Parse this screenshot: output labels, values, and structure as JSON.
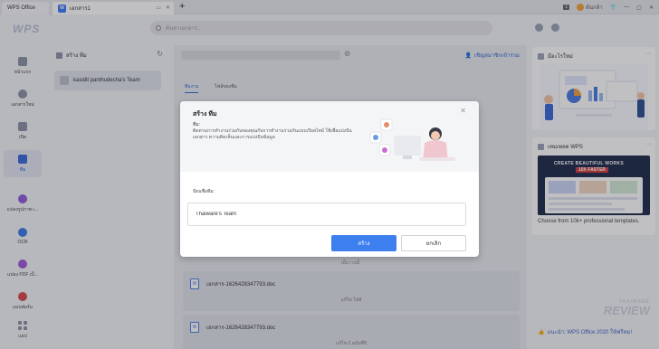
{
  "tabs": {
    "app_label": "WPS Office",
    "doc_label": "เอกสาร1",
    "doc_icon_letter": "W",
    "new_tab": "+"
  },
  "topbar": {
    "badge": "1",
    "user": "ต้นกล้า",
    "icons": [
      "minimize-icon",
      "shirt-icon",
      "settings-icon"
    ]
  },
  "header": {
    "logo": "WPS",
    "search_placeholder": "ค้นหาเอกสาร..."
  },
  "leftnav": {
    "items": [
      {
        "label": "หน้าแรก",
        "icon": "home-icon"
      },
      {
        "label": "เอกสารใหม่",
        "icon": "new-doc-icon"
      },
      {
        "label": "เปิด",
        "icon": "folder-icon"
      },
      {
        "label": "ทีม",
        "icon": "team-icon",
        "active": true
      },
      {
        "label": "แปลงรูปภาพ เ...",
        "icon": "pic-convert-icon"
      },
      {
        "label": "OCR",
        "icon": "ocr-icon"
      },
      {
        "label": "แปลง PDF เป็...",
        "icon": "pdf-convert-icon"
      },
      {
        "label": "แบบฟอร์ม",
        "icon": "form-icon"
      },
      {
        "label": "แอป",
        "icon": "apps-icon"
      }
    ]
  },
  "teampanel": {
    "header": "สร้าง ทีม",
    "team_name": "kasidit panthudecha's Team"
  },
  "main": {
    "invite": "เชิญสมาชิกเข้าร่วม",
    "tabs": [
      "ทีมงาน",
      "ไฟล์ของทีม"
    ],
    "history_label": "เมื่อวานนี้",
    "files": [
      {
        "name": "เอกสาร-1626428347793.doc",
        "meta": "แก้ไข ไฟล์"
      },
      {
        "name": "เอกสาร-1626428347793.doc",
        "meta": "แก้ไข 2 ฉบับที่ปิ"
      }
    ]
  },
  "rightpanel": {
    "card1_title": "มีอะไรใหม่",
    "card2_title": "เทมเพลต WPS",
    "promo_line1": "CREATE BEAUTIFUL WORKS",
    "promo_line2": "10X FASTER",
    "promo_desc": "Choose from 10k+ professional templates.",
    "bottom_link": "แนะนำ: WPS Office 2020 ใช้ฟรีหม!"
  },
  "watermark": {
    "line1": "THAIWARE",
    "line2": "REVIEW"
  },
  "dialog": {
    "title": "สร้าง ทีม",
    "subtitle": "ทีม:",
    "description": "ติดตามการทำงานร่วมกันของคุณกับการทำงานร่วมกันแบบเรียลไทม์ ใช้เพื่อแบ่งปันเอกสาร ความคิดเห็นและการแบ่งปันข้อมูล",
    "name_label": "ป้อนชื่อทีม:",
    "name_value": "Thaiware's Team",
    "create_label": "สร้าง",
    "cancel_label": "ยกเลิก"
  },
  "colors": {
    "accent": "#3e7ff0",
    "overlay": "rgba(30,30,40,0.28)"
  }
}
